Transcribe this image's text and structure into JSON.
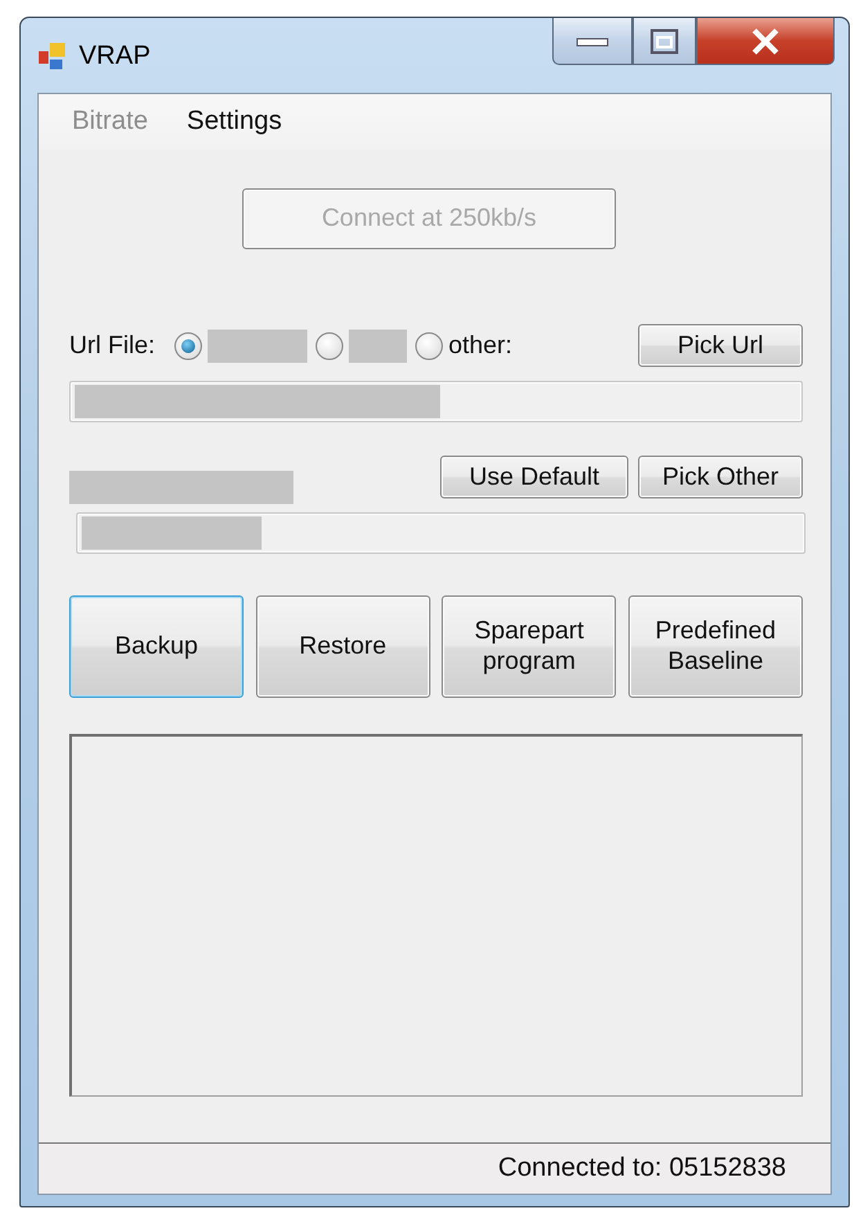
{
  "window": {
    "title": "VRAP"
  },
  "menu": [
    {
      "label": "Bitrate",
      "disabled": true
    },
    {
      "label": "Settings",
      "disabled": false
    }
  ],
  "connect_button": {
    "label": "Connect at 250kb/s",
    "disabled": true
  },
  "url_file": {
    "label": "Url File:",
    "options": [
      {
        "kind": "redacted",
        "selected": true
      },
      {
        "kind": "redacted",
        "selected": false
      },
      {
        "kind": "text",
        "label": "other:",
        "selected": false
      }
    ],
    "pick_button": "Pick Url"
  },
  "file_buttons": [
    "Use Default",
    "Pick Other"
  ],
  "actions": [
    {
      "label": "Backup",
      "focused": true
    },
    {
      "label": "Restore",
      "focused": false
    },
    {
      "label": "Sparepart program",
      "focused": false
    },
    {
      "label": "Predefined Baseline",
      "focused": false
    }
  ],
  "status_bar": "Connected to: 05152838"
}
